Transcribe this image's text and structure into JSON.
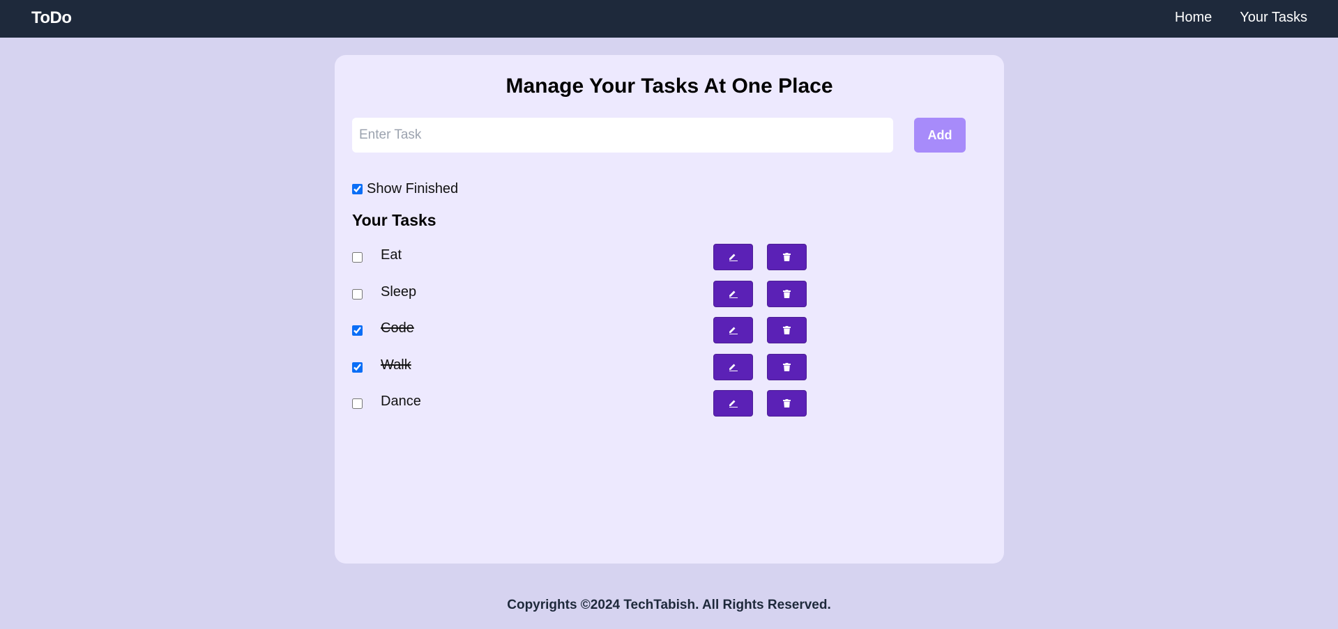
{
  "navbar": {
    "brand": "ToDo",
    "links": [
      "Home",
      "Your Tasks"
    ]
  },
  "main": {
    "heading": "Manage Your Tasks At One Place",
    "input_placeholder": "Enter Task",
    "input_value": "",
    "add_label": "Add",
    "show_finished_label": "Show Finished",
    "show_finished_checked": true,
    "tasks_title": "Your Tasks",
    "tasks": [
      {
        "text": "Eat",
        "done": false
      },
      {
        "text": "Sleep",
        "done": false
      },
      {
        "text": "Code",
        "done": true
      },
      {
        "text": "Walk",
        "done": true
      },
      {
        "text": "Dance",
        "done": false
      }
    ],
    "edit_icon": "pencil-icon",
    "delete_icon": "trash-icon"
  },
  "footer": {
    "text": "Copyrights ©2024 TechTabish. All Rights Reserved."
  },
  "colors": {
    "navbar_bg": "#1e293b",
    "page_bg": "#d6d3f0",
    "card_bg": "#ede9fe",
    "add_button": "#a78bfa",
    "action_button": "#5b21b6",
    "checkbox_accent": "#0b6ef6"
  }
}
